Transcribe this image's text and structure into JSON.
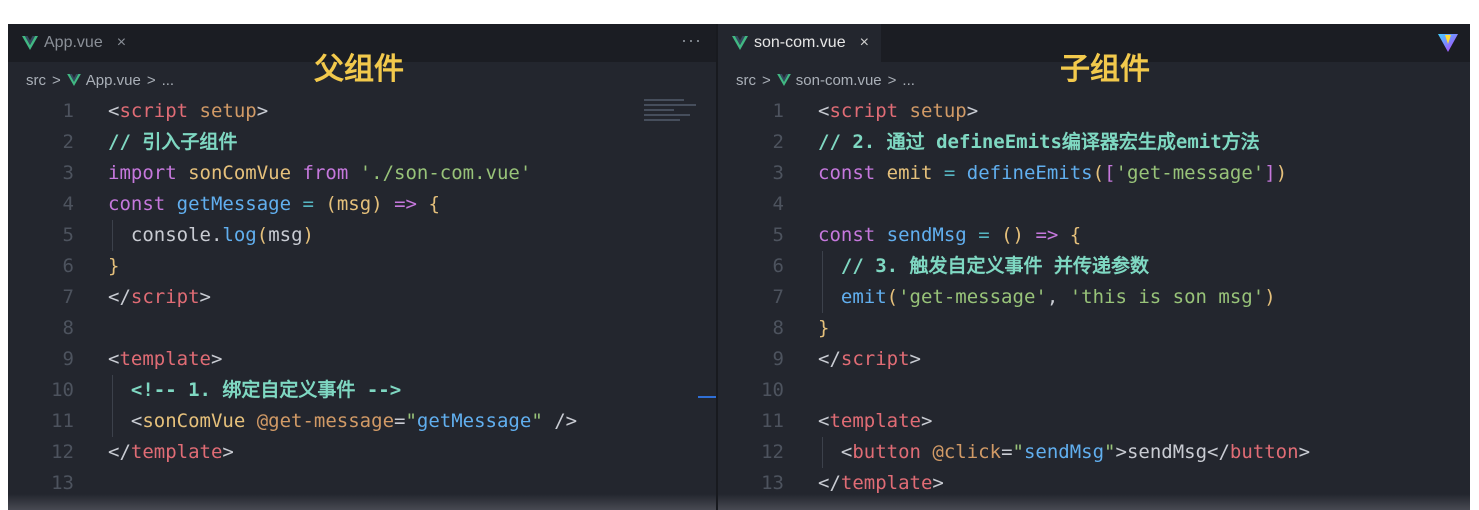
{
  "left": {
    "tab": {
      "label": "App.vue",
      "close": "×"
    },
    "more": "···",
    "breadcrumb": {
      "root": "src",
      "sep": ">",
      "file": "App.vue",
      "tail": "..."
    },
    "annotation": "父组件",
    "lines": [
      {
        "n": "1",
        "tokens": [
          [
            "t-punc",
            "<"
          ],
          [
            "t-tag",
            "script"
          ],
          [
            "t-plain",
            " "
          ],
          [
            "t-attr",
            "setup"
          ],
          [
            "t-punc",
            ">"
          ]
        ]
      },
      {
        "n": "2",
        "tokens": [
          [
            "t-com",
            "// 引入子组件"
          ]
        ]
      },
      {
        "n": "3",
        "tokens": [
          [
            "t-kw",
            "import"
          ],
          [
            "t-plain",
            " "
          ],
          [
            "t-id",
            "sonComVue"
          ],
          [
            "t-plain",
            " "
          ],
          [
            "t-kw",
            "from"
          ],
          [
            "t-plain",
            " "
          ],
          [
            "t-str",
            "'./son-com.vue'"
          ]
        ]
      },
      {
        "n": "4",
        "tokens": [
          [
            "t-kw",
            "const"
          ],
          [
            "t-plain",
            " "
          ],
          [
            "t-fn",
            "getMessage"
          ],
          [
            "t-plain",
            " "
          ],
          [
            "t-op",
            "="
          ],
          [
            "t-plain",
            " "
          ],
          [
            "t-brace",
            "("
          ],
          [
            "t-var",
            "msg"
          ],
          [
            "t-brace",
            ")"
          ],
          [
            "t-plain",
            " "
          ],
          [
            "t-kw",
            "=>"
          ],
          [
            "t-plain",
            " "
          ],
          [
            "t-brace",
            "{"
          ]
        ]
      },
      {
        "n": "5",
        "guide": true,
        "tokens": [
          [
            "t-plain",
            "  console"
          ],
          [
            "t-punc",
            "."
          ],
          [
            "t-fn",
            "log"
          ],
          [
            "t-brace",
            "("
          ],
          [
            "t-plain",
            "msg"
          ],
          [
            "t-brace",
            ")"
          ]
        ]
      },
      {
        "n": "6",
        "tokens": [
          [
            "t-brace",
            "}"
          ]
        ]
      },
      {
        "n": "7",
        "tokens": [
          [
            "t-punc",
            "</"
          ],
          [
            "t-tag",
            "script"
          ],
          [
            "t-punc",
            ">"
          ]
        ]
      },
      {
        "n": "8",
        "tokens": []
      },
      {
        "n": "9",
        "tokens": [
          [
            "t-punc",
            "<"
          ],
          [
            "t-tag",
            "template"
          ],
          [
            "t-punc",
            ">"
          ]
        ]
      },
      {
        "n": "10",
        "guide": true,
        "tokens": [
          [
            "t-com",
            "  <!-- 1. 绑定自定义事件 -->"
          ]
        ]
      },
      {
        "n": "11",
        "guide": true,
        "tokens": [
          [
            "t-punc",
            "  <"
          ],
          [
            "t-id",
            "sonComVue"
          ],
          [
            "t-plain",
            " "
          ],
          [
            "t-attr",
            "@get-message"
          ],
          [
            "t-punc",
            "="
          ],
          [
            "t-str",
            "\""
          ],
          [
            "t-fn",
            "getMessage"
          ],
          [
            "t-str",
            "\""
          ],
          [
            "t-plain",
            " "
          ],
          [
            "t-punc",
            "/>"
          ]
        ]
      },
      {
        "n": "12",
        "tokens": [
          [
            "t-punc",
            "</"
          ],
          [
            "t-tag",
            "template"
          ],
          [
            "t-punc",
            ">"
          ]
        ]
      },
      {
        "n": "13",
        "tokens": []
      }
    ]
  },
  "right": {
    "tab": {
      "label": "son-com.vue",
      "close": "×"
    },
    "breadcrumb": {
      "root": "src",
      "sep": ">",
      "file": "son-com.vue",
      "tail": "..."
    },
    "annotation": "子组件",
    "lines": [
      {
        "n": "1",
        "tokens": [
          [
            "t-punc",
            "<"
          ],
          [
            "t-tag",
            "script"
          ],
          [
            "t-plain",
            " "
          ],
          [
            "t-attr",
            "setup"
          ],
          [
            "t-punc",
            ">"
          ]
        ]
      },
      {
        "n": "2",
        "tokens": [
          [
            "t-com",
            "// 2. 通过 defineEmits编译器宏生成emit方法"
          ]
        ]
      },
      {
        "n": "3",
        "tokens": [
          [
            "t-kw",
            "const"
          ],
          [
            "t-plain",
            " "
          ],
          [
            "t-id",
            "emit"
          ],
          [
            "t-plain",
            " "
          ],
          [
            "t-op",
            "="
          ],
          [
            "t-plain",
            " "
          ],
          [
            "t-fn",
            "defineEmits"
          ],
          [
            "t-brace",
            "("
          ],
          [
            "t-kw",
            "["
          ],
          [
            "t-str",
            "'get-message'"
          ],
          [
            "t-kw",
            "]"
          ],
          [
            "t-brace",
            ")"
          ]
        ]
      },
      {
        "n": "4",
        "tokens": []
      },
      {
        "n": "5",
        "tokens": [
          [
            "t-kw",
            "const"
          ],
          [
            "t-plain",
            " "
          ],
          [
            "t-fn",
            "sendMsg"
          ],
          [
            "t-plain",
            " "
          ],
          [
            "t-op",
            "="
          ],
          [
            "t-plain",
            " "
          ],
          [
            "t-brace",
            "()"
          ],
          [
            "t-plain",
            " "
          ],
          [
            "t-kw",
            "=>"
          ],
          [
            "t-plain",
            " "
          ],
          [
            "t-brace",
            "{"
          ]
        ]
      },
      {
        "n": "6",
        "guide": true,
        "tokens": [
          [
            "t-com",
            "  // 3. 触发自定义事件 并传递参数"
          ]
        ]
      },
      {
        "n": "7",
        "guide": true,
        "tokens": [
          [
            "t-plain",
            "  "
          ],
          [
            "t-fn",
            "emit"
          ],
          [
            "t-brace",
            "("
          ],
          [
            "t-str",
            "'get-message'"
          ],
          [
            "t-plain",
            ", "
          ],
          [
            "t-str",
            "'this is son msg'"
          ],
          [
            "t-brace",
            ")"
          ]
        ]
      },
      {
        "n": "8",
        "tokens": [
          [
            "t-brace",
            "}"
          ]
        ]
      },
      {
        "n": "9",
        "tokens": [
          [
            "t-punc",
            "</"
          ],
          [
            "t-tag",
            "script"
          ],
          [
            "t-punc",
            ">"
          ]
        ]
      },
      {
        "n": "10",
        "tokens": []
      },
      {
        "n": "11",
        "tokens": [
          [
            "t-punc",
            "<"
          ],
          [
            "t-tag",
            "template"
          ],
          [
            "t-punc",
            ">"
          ]
        ]
      },
      {
        "n": "12",
        "guide": true,
        "tokens": [
          [
            "t-punc",
            "  <"
          ],
          [
            "t-tag",
            "button"
          ],
          [
            "t-plain",
            " "
          ],
          [
            "t-attr",
            "@click"
          ],
          [
            "t-punc",
            "="
          ],
          [
            "t-str",
            "\""
          ],
          [
            "t-fn",
            "sendMsg"
          ],
          [
            "t-str",
            "\""
          ],
          [
            "t-punc",
            ">"
          ],
          [
            "t-plain",
            "sendMsg"
          ],
          [
            "t-punc",
            "</"
          ],
          [
            "t-tag",
            "button"
          ],
          [
            "t-punc",
            ">"
          ]
        ]
      },
      {
        "n": "13",
        "tokens": [
          [
            "t-punc",
            "</"
          ],
          [
            "t-tag",
            "template"
          ],
          [
            "t-punc",
            ">"
          ]
        ]
      }
    ]
  },
  "colors": {
    "vue_green": "#41b883",
    "vue_dark": "#35495e",
    "annotation": "#f2c94c"
  }
}
